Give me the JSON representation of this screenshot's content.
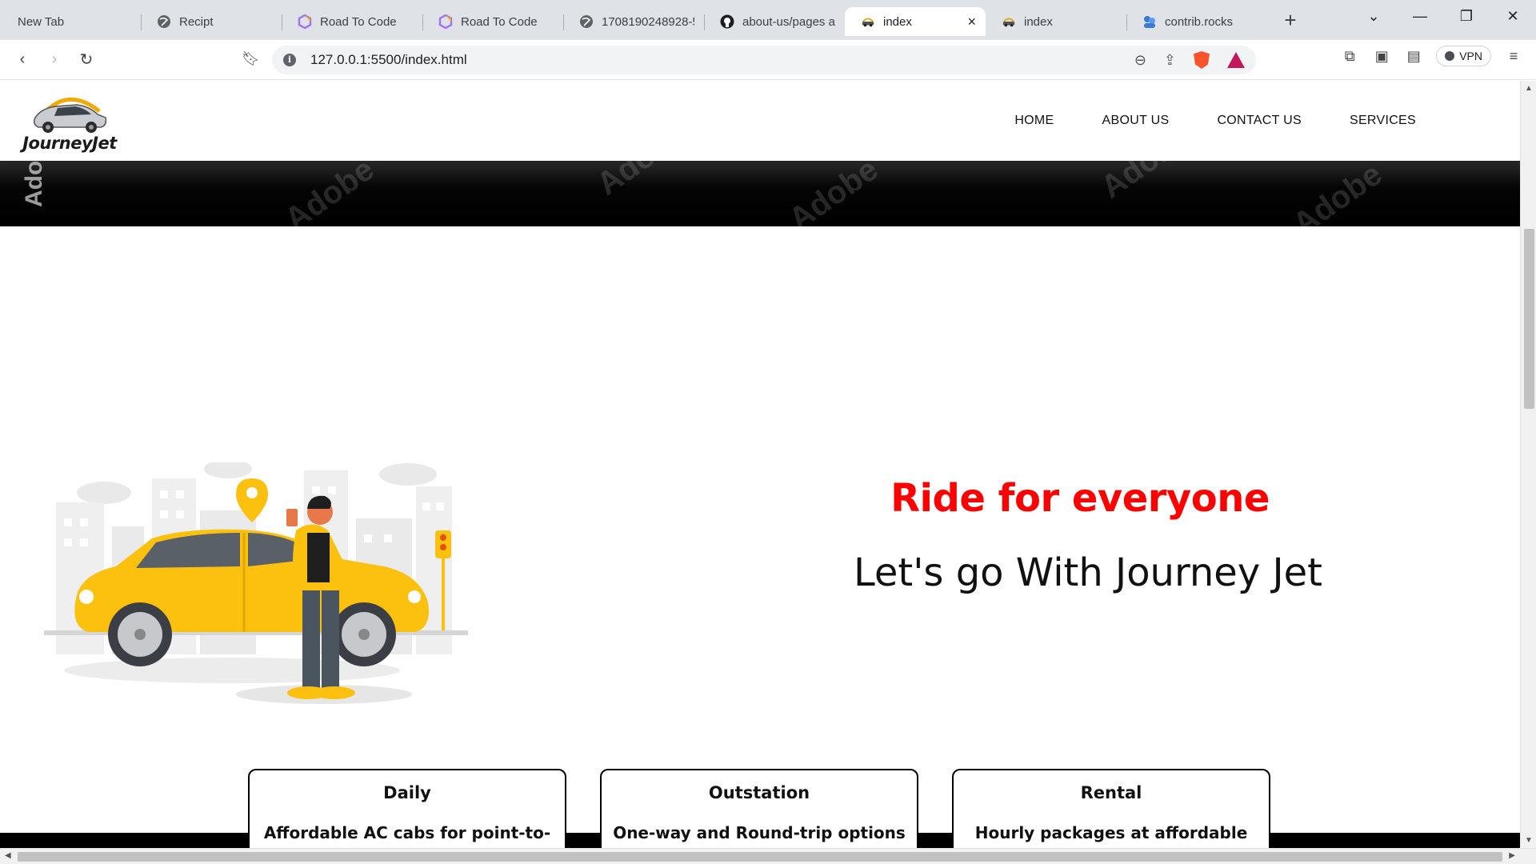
{
  "browser": {
    "tabs": [
      {
        "title": "New Tab",
        "icon": "none"
      },
      {
        "title": "Recipt",
        "icon": "globe-icon"
      },
      {
        "title": "Road To Code",
        "icon": "hexagon-icon"
      },
      {
        "title": "Road To Code",
        "icon": "hexagon-icon"
      },
      {
        "title": "1708190248928-5",
        "icon": "globe-icon"
      },
      {
        "title": "about-us/pages a",
        "icon": "github-icon"
      },
      {
        "title": "index",
        "icon": "car-icon",
        "active": true
      },
      {
        "title": "index",
        "icon": "car-icon"
      },
      {
        "title": "contrib.rocks",
        "icon": "people-icon"
      }
    ],
    "url": "127.0.0.1:5500/index.html",
    "vpn_label": "VPN",
    "close_glyph": "×",
    "newtab_glyph": "+"
  },
  "site": {
    "logo_text": "JourneyJet",
    "nav": [
      "HOME",
      "ABOUT US",
      "CONTACT US",
      "SERVICES"
    ],
    "banner_watermark": "Adobe",
    "hero": {
      "title": "Ride for everyone",
      "subtitle": "Let's go With Journey Jet",
      "title_color": "#ff0000",
      "car_color": "#fbc10e"
    },
    "cards": [
      {
        "title": "Daily",
        "desc": "Affordable AC cabs for point-to-"
      },
      {
        "title": "Outstation",
        "desc": "One-way and Round-trip options"
      },
      {
        "title": "Rental",
        "desc": "Hourly packages at affordable"
      }
    ]
  }
}
